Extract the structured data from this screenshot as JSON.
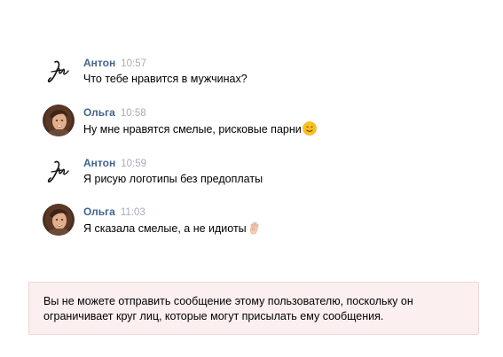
{
  "messages": [
    {
      "author": "Антон",
      "time": "10:57",
      "text": "Что тебе нравится в мужчинах?",
      "avatar": "signature-logo",
      "emoji": ""
    },
    {
      "author": "Ольга",
      "time": "10:58",
      "text": "Ну мне нравятся смелые, рисковые парни",
      "avatar": "woman-photo",
      "emoji": "smiling-face-emoji"
    },
    {
      "author": "Антон",
      "time": "10:59",
      "text": "Я рисую логотипы без предоплаты",
      "avatar": "signature-logo",
      "emoji": ""
    },
    {
      "author": "Ольга",
      "time": "11:03",
      "text": "Я сказала смелые, а не идиоты",
      "avatar": "woman-photo",
      "emoji": "ok-hand-emoji"
    }
  ],
  "notice": {
    "line1": "Вы не можете отправить сообщение этому пользователю, поскольку он",
    "line2": "ограничивает круг лиц, которые могут присылать ему сообщения."
  },
  "colors": {
    "author": "#42648b",
    "time": "#a4adb8",
    "notice_bg": "#fbeff0",
    "notice_border": "#f0d7d9"
  }
}
